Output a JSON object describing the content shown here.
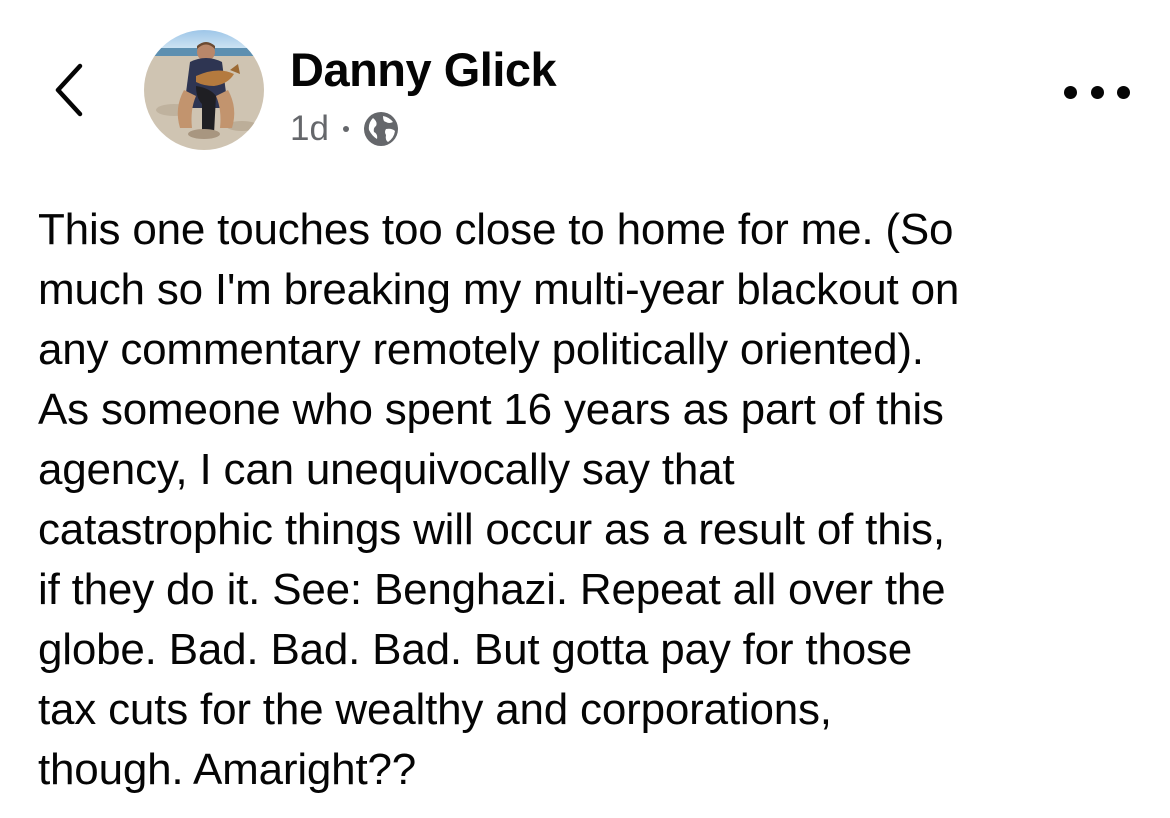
{
  "header": {
    "back_icon": "chevron-left-icon",
    "author_name": "Danny Glick",
    "timestamp": "1d",
    "privacy_icon": "globe-icon",
    "more_icon": "more-horizontal-icon"
  },
  "post": {
    "lines": [
      "This one touches too close to home for me. (So",
      "much so I'm breaking my multi-year blackout on",
      "any commentary remotely politically oriented).",
      "As someone who spent 16 years as part of this",
      "agency, I can unequivocally say that",
      "catastrophic things will occur as a result of this,",
      "if they do it. See: Benghazi. Repeat all over the",
      "globe. Bad. Bad. Bad. But gotta pay for those",
      "tax cuts for the wealthy and corporations,",
      "though. Amaright??"
    ]
  },
  "colors": {
    "text": "#050505",
    "secondary_text": "#65676b",
    "background": "#ffffff"
  }
}
